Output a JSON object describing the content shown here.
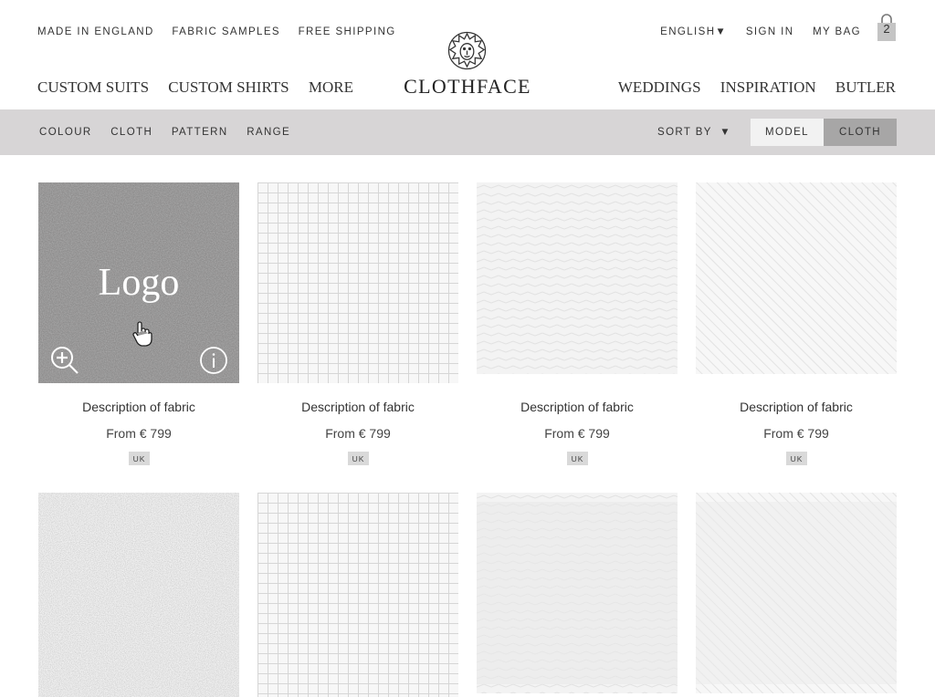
{
  "utility_nav": {
    "left": [
      "MADE IN ENGLAND",
      "FABRIC SAMPLES",
      "FREE SHIPPING"
    ],
    "language": "ENGLISH",
    "sign_in": "SIGN IN",
    "my_bag": "MY BAG",
    "bag_count": "2"
  },
  "brand": {
    "name": "CLOTHFACE",
    "emblem_icon": "lion-head-icon"
  },
  "main_nav": {
    "left": [
      "CUSTOM SUITS",
      "CUSTOM SHIRTS",
      "MORE"
    ],
    "right": [
      "WEDDINGS",
      "INSPIRATION",
      "BUTLER"
    ]
  },
  "filter_bar": {
    "filters": [
      "COLOUR",
      "CLOTH",
      "PATTERN",
      "RANGE"
    ],
    "sort_by": "SORT BY",
    "view_toggle": {
      "model": "MODEL",
      "cloth": "CLOTH",
      "active": "cloth"
    }
  },
  "products": [
    {
      "description": "Description of fabric",
      "price": "From € 799",
      "badge": "UK",
      "overlay": "Logo",
      "pattern": "solid-dark"
    },
    {
      "description": "Description of fabric",
      "price": "From € 799",
      "badge": "UK",
      "pattern": "grid"
    },
    {
      "description": "Description of fabric",
      "price": "From € 799",
      "badge": "UK",
      "pattern": "herringbone"
    },
    {
      "description": "Description of fabric",
      "price": "From € 799",
      "badge": "UK",
      "pattern": "diagonal"
    },
    {
      "pattern": "speckle"
    },
    {
      "pattern": "grid"
    },
    {
      "pattern": "herringbone"
    },
    {
      "pattern": "diagonal"
    }
  ],
  "colors": {
    "filter_bar": "#d7d5d6",
    "toggle_active": "#a7a6a6",
    "toggle_inactive": "#f2f2f2",
    "badge": "#d9d9d9",
    "text": "#333333"
  },
  "icons": [
    "zoom-in-icon",
    "info-icon",
    "hand-cursor-icon",
    "shopping-bag-icon",
    "caret-down-icon"
  ]
}
